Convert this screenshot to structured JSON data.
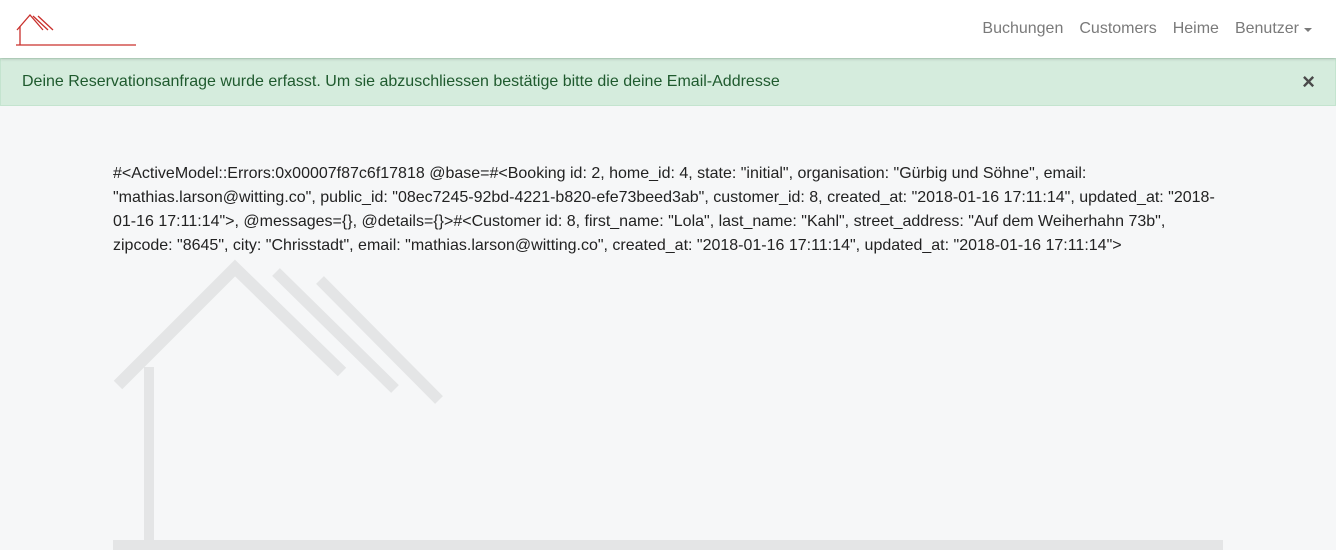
{
  "navbar": {
    "links": [
      {
        "label": "Buchungen"
      },
      {
        "label": "Customers"
      },
      {
        "label": "Heime"
      },
      {
        "label": "Benutzer"
      }
    ]
  },
  "alert": {
    "message": "Deine Reservationsanfrage wurde erfasst. Um sie abzuschliessen bestätige bitte die deine Email-Addresse",
    "close_symbol": "×"
  },
  "debug_output": "#<ActiveModel::Errors:0x00007f87c6f17818 @base=#<Booking id: 2, home_id: 4, state: \"initial\", organisation: \"Gürbig und Söhne\", email: \"mathias.larson@witting.co\", public_id: \"08ec7245-92bd-4221-b820-efe73beed3ab\", customer_id: 8, created_at: \"2018-01-16 17:11:14\", updated_at: \"2018-01-16 17:11:14\">, @messages={}, @details={}>#<Customer id: 8, first_name: \"Lola\", last_name: \"Kahl\", street_address: \"Auf dem Weiherhahn 73b\", zipcode: \"8645\", city: \"Chrisstadt\", email: \"mathias.larson@witting.co\", created_at: \"2018-01-16 17:11:14\", updated_at: \"2018-01-16 17:11:14\">",
  "colors": {
    "brand_red": "#c9302c",
    "alert_bg": "#d5ecdd",
    "alert_text": "#1f5a2e",
    "nav_text": "#7a7a7a",
    "watermark": "#e4e5e6"
  },
  "icons": {
    "brand": "house-logo-icon",
    "watermark": "house-watermark-icon",
    "close": "close-icon",
    "dropdown": "caret-down-icon"
  }
}
